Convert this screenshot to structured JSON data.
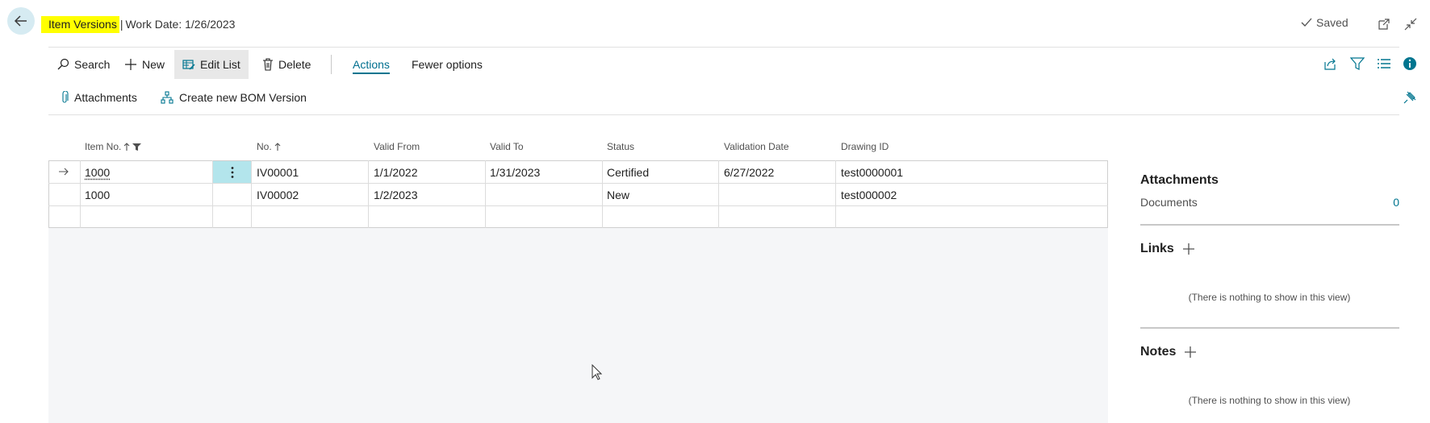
{
  "header": {
    "title": "Item Versions",
    "separator": "|",
    "work_date": "Work Date: 1/26/2023",
    "saved_label": "Saved"
  },
  "actions": {
    "search": "Search",
    "new": "New",
    "edit_list": "Edit List",
    "delete": "Delete",
    "actions_tab": "Actions",
    "fewer_options": "Fewer options",
    "attachments": "Attachments",
    "create_bom_version": "Create new BOM Version"
  },
  "grid": {
    "columns": [
      "Item No.",
      "No.",
      "Valid From",
      "Valid To",
      "Status",
      "Validation Date",
      "Drawing ID"
    ],
    "rows": [
      {
        "item_no": "1000",
        "no": "IV00001",
        "valid_from": "1/1/2022",
        "valid_to": "1/31/2023",
        "status": "Certified",
        "validation_date": "6/27/2022",
        "drawing_id": "test0000001"
      },
      {
        "item_no": "1000",
        "no": "IV00002",
        "valid_from": "1/2/2023",
        "valid_to": "",
        "status": "New",
        "validation_date": "",
        "drawing_id": "test000002"
      }
    ]
  },
  "factbox": {
    "attachments_title": "Attachments",
    "documents_label": "Documents",
    "documents_count": "0",
    "links_title": "Links",
    "links_empty": "(There is nothing to show in this view)",
    "notes_title": "Notes",
    "notes_empty": "(There is nothing to show in this view)"
  },
  "colors": {
    "accent": "#00758f",
    "highlight": "#ffff00",
    "selected_cell": "#b3e5ec"
  }
}
